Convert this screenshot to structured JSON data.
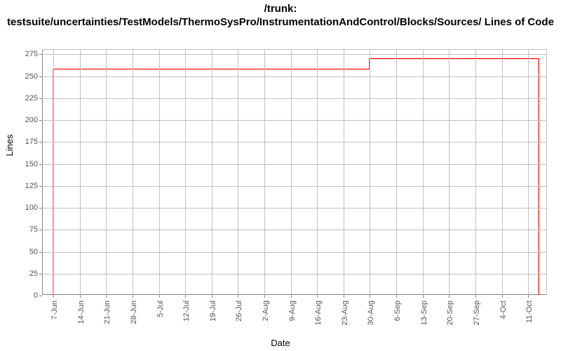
{
  "chart_data": {
    "type": "line",
    "title": "/trunk:\ntestsuite/uncertainties/TestModels/ThermoSysPro/InstrumentationAndControl/Blocks/Sources/ Lines of Code",
    "xlabel": "Date",
    "ylabel": "Lines",
    "ylim": [
      0,
      280
    ],
    "yticks": [
      0,
      25,
      50,
      75,
      100,
      125,
      150,
      175,
      200,
      225,
      250,
      275
    ],
    "xticks": [
      "7-Jun",
      "14-Jun",
      "21-Jun",
      "28-Jun",
      "5-Jul",
      "12-Jul",
      "19-Jul",
      "26-Jul",
      "2-Aug",
      "9-Aug",
      "16-Aug",
      "23-Aug",
      "30-Aug",
      "6-Sep",
      "13-Sep",
      "20-Sep",
      "27-Sep",
      "4-Oct",
      "11-Oct"
    ],
    "x_numeric_days": [
      0,
      7,
      14,
      21,
      28,
      35,
      42,
      49,
      56,
      63,
      70,
      77,
      84,
      91,
      98,
      105,
      112,
      119,
      126
    ],
    "x_range_days": [
      -3,
      131
    ],
    "line_color": "#ff0000",
    "series": [
      {
        "name": "Lines of Code",
        "points": [
          {
            "date": "7-Jun",
            "day": 0,
            "value": 0
          },
          {
            "date": "7-Jun",
            "day": 0,
            "value": 258
          },
          {
            "date": "30-Aug",
            "day": 84,
            "value": 258
          },
          {
            "date": "30-Aug",
            "day": 84,
            "value": 270
          },
          {
            "date": "14-Oct",
            "day": 129,
            "value": 270
          },
          {
            "date": "14-Oct",
            "day": 129,
            "value": 0
          }
        ]
      }
    ]
  }
}
